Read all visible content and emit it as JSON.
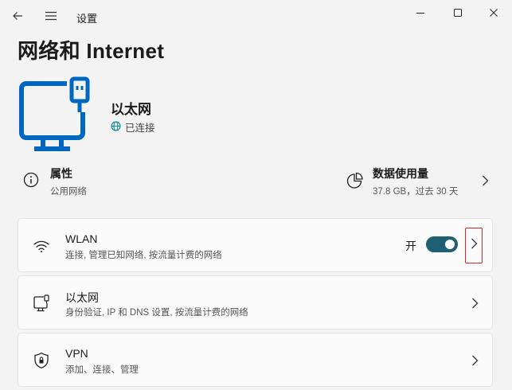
{
  "window": {
    "app_title": "设置",
    "back_icon": "back-arrow-icon",
    "menu_icon": "hamburger-menu-icon",
    "controls": [
      "minimize-icon",
      "maximize-icon",
      "close-icon"
    ]
  },
  "page": {
    "title": "网络和 Internet"
  },
  "hero": {
    "icon": "ethernet-monitor-icon",
    "name": "以太网",
    "status": "已连接",
    "status_icon": "globe-icon",
    "accent": "#0067c0"
  },
  "properties": {
    "label": "属性",
    "sub": "公用网络",
    "icon": "info-icon"
  },
  "data_usage": {
    "label": "数据使用量",
    "sub": "37.8 GB，过去 30 天",
    "icon": "pie-chart-icon"
  },
  "cards": {
    "wlan": {
      "title": "WLAN",
      "sub": "连接, 管理已知网络, 按流量计费的网络",
      "icon": "wifi-icon",
      "toggle_label": "开",
      "toggle_on": true,
      "toggle_color": "#1e5f74"
    },
    "ethernet": {
      "title": "以太网",
      "sub": "身份验证, IP 和 DNS 设置, 按流量计费的网络",
      "icon": "ethernet-icon"
    },
    "vpn": {
      "title": "VPN",
      "sub": "添加、连接、管理",
      "icon": "shield-icon"
    }
  },
  "highlight_color": "#e0242b"
}
